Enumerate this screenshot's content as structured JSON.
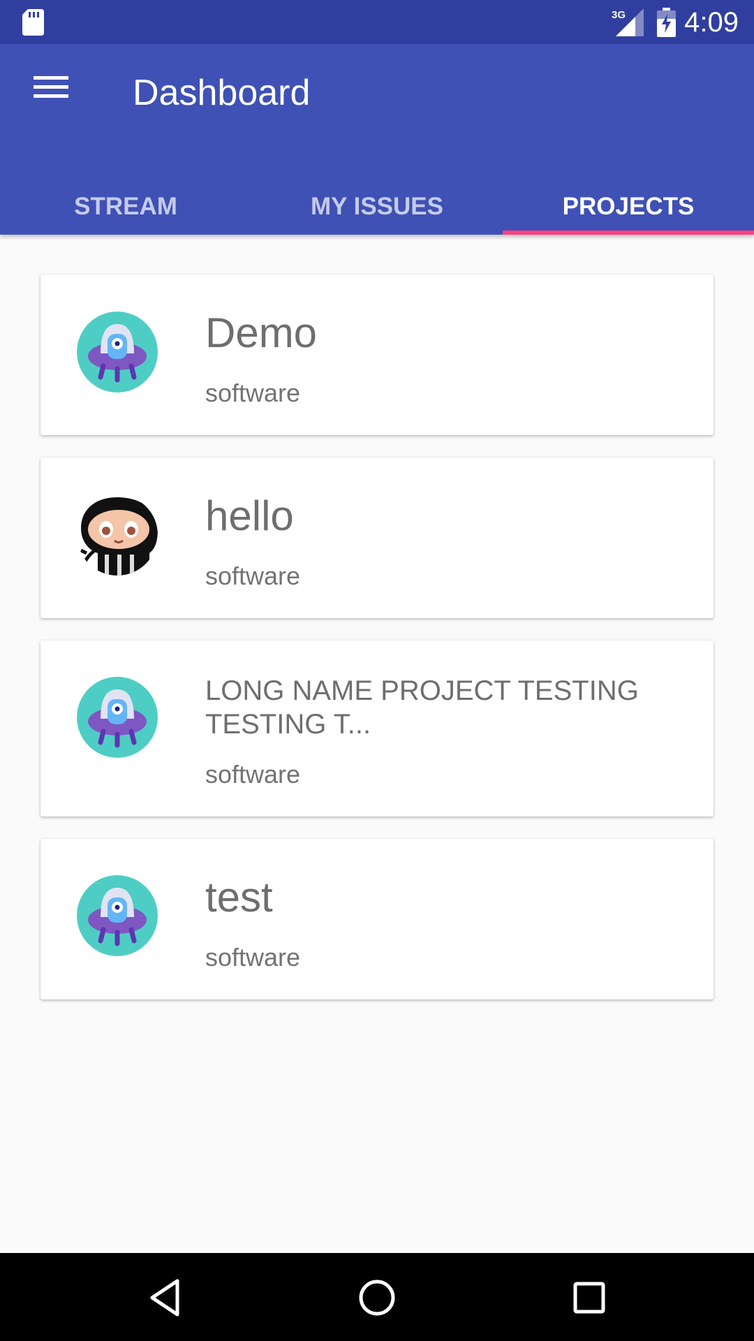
{
  "status_bar": {
    "network": "3G",
    "time": "4:09",
    "icons": [
      "sd-card-icon",
      "signal-icon",
      "battery-icon"
    ]
  },
  "app_bar": {
    "title": "Dashboard",
    "menu_icon": "menu-icon",
    "background": "#3f51b5"
  },
  "tabs": [
    {
      "label": "STREAM",
      "active": false
    },
    {
      "label": "MY ISSUES",
      "active": false
    },
    {
      "label": "PROJECTS",
      "active": true
    }
  ],
  "tab_indicator_color": "#ff4081",
  "projects": [
    {
      "name": "Demo",
      "type": "software",
      "avatar": "alien-ufo-avatar"
    },
    {
      "name": "hello",
      "type": "software",
      "avatar": "octocat-avatar"
    },
    {
      "name": "LONG NAME PROJECT TESTING TESTING T...",
      "type": "software",
      "avatar": "alien-ufo-avatar"
    },
    {
      "name": "test",
      "type": "software",
      "avatar": "alien-ufo-avatar"
    }
  ],
  "nav_bar": {
    "buttons": [
      "back-icon",
      "home-icon",
      "recents-icon"
    ]
  }
}
